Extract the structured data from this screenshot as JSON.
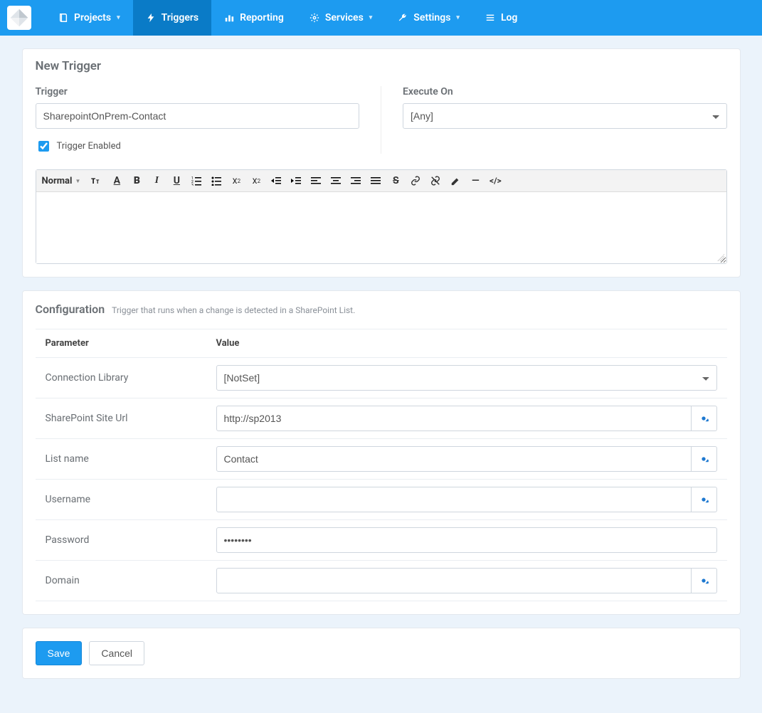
{
  "nav": {
    "items": [
      {
        "label": "Projects",
        "icon": "book",
        "dropdown": true,
        "active": false
      },
      {
        "label": "Triggers",
        "icon": "bolt",
        "dropdown": false,
        "active": true
      },
      {
        "label": "Reporting",
        "icon": "chart",
        "dropdown": false,
        "active": false
      },
      {
        "label": "Services",
        "icon": "cogs",
        "dropdown": true,
        "active": false
      },
      {
        "label": "Settings",
        "icon": "wrench",
        "dropdown": true,
        "active": false
      },
      {
        "label": "Log",
        "icon": "list",
        "dropdown": false,
        "active": false
      }
    ]
  },
  "panel": {
    "title": "New Trigger",
    "trigger_label": "Trigger",
    "trigger_value": "SharepointOnPrem-Contact",
    "execute_label": "Execute On",
    "execute_selected": "[Any]",
    "enabled_label": "Trigger Enabled",
    "enabled": true,
    "rte_format": "Normal"
  },
  "config": {
    "title": "Configuration",
    "subtitle": "Trigger that runs when a change is detected in a SharePoint List.",
    "col_param": "Parameter",
    "col_value": "Value",
    "rows": [
      {
        "param": "Connection Library",
        "type": "select",
        "value": "[NotSet]",
        "gear": false
      },
      {
        "param": "SharePoint Site Url",
        "type": "text",
        "value": "http://sp2013",
        "gear": true
      },
      {
        "param": "List name",
        "type": "text",
        "value": "Contact",
        "gear": true
      },
      {
        "param": "Username",
        "type": "text",
        "value": "",
        "gear": true
      },
      {
        "param": "Password",
        "type": "password",
        "value": "••••••••",
        "gear": false
      },
      {
        "param": "Domain",
        "type": "text",
        "value": "",
        "gear": true
      }
    ]
  },
  "actions": {
    "save": "Save",
    "cancel": "Cancel"
  }
}
